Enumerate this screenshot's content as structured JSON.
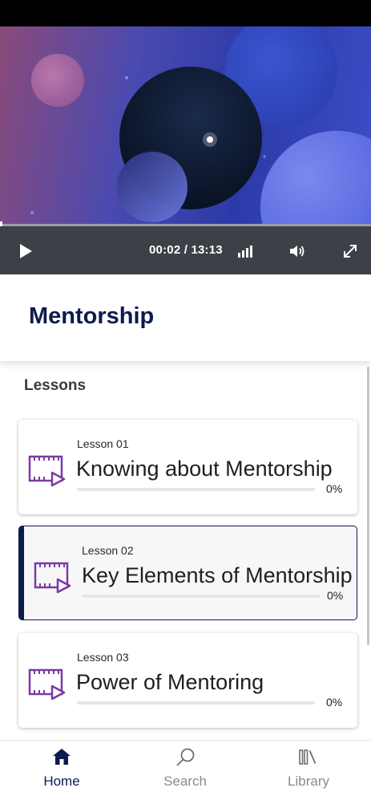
{
  "player": {
    "time_current": "00:02",
    "time_total": "13:13",
    "time_display": "00:02 / 13:13",
    "progress_fraction": 0.0025,
    "icons": {
      "play": "play-icon",
      "quality": "signal-bars-icon",
      "volume": "volume-icon",
      "fullscreen": "expand-icon"
    }
  },
  "course": {
    "title": "Mentorship"
  },
  "lessons_section": {
    "heading": "Lessons",
    "items": [
      {
        "number": "Lesson 01",
        "title": "Knowing about Mentorship",
        "progress_label": "0%",
        "progress_fraction": 0,
        "icon": "video-film-icon",
        "active": false
      },
      {
        "number": "Lesson 02",
        "title": "Key Elements of Mentorship",
        "progress_label": "0%",
        "progress_fraction": 0,
        "icon": "video-film-icon",
        "active": true
      },
      {
        "number": "Lesson 03",
        "title": "Power of Mentoring",
        "progress_label": "0%",
        "progress_fraction": 0,
        "icon": "video-film-icon",
        "active": false
      }
    ]
  },
  "bottom_nav": {
    "items": [
      {
        "label": "Home",
        "icon": "home-icon",
        "active": true
      },
      {
        "label": "Search",
        "icon": "search-icon",
        "active": false
      },
      {
        "label": "Library",
        "icon": "library-icon",
        "active": false
      }
    ]
  },
  "colors": {
    "accent": "#0d1b4d",
    "lesson_icon": "#7b3aa6",
    "controls_bg": "#3d4147"
  }
}
